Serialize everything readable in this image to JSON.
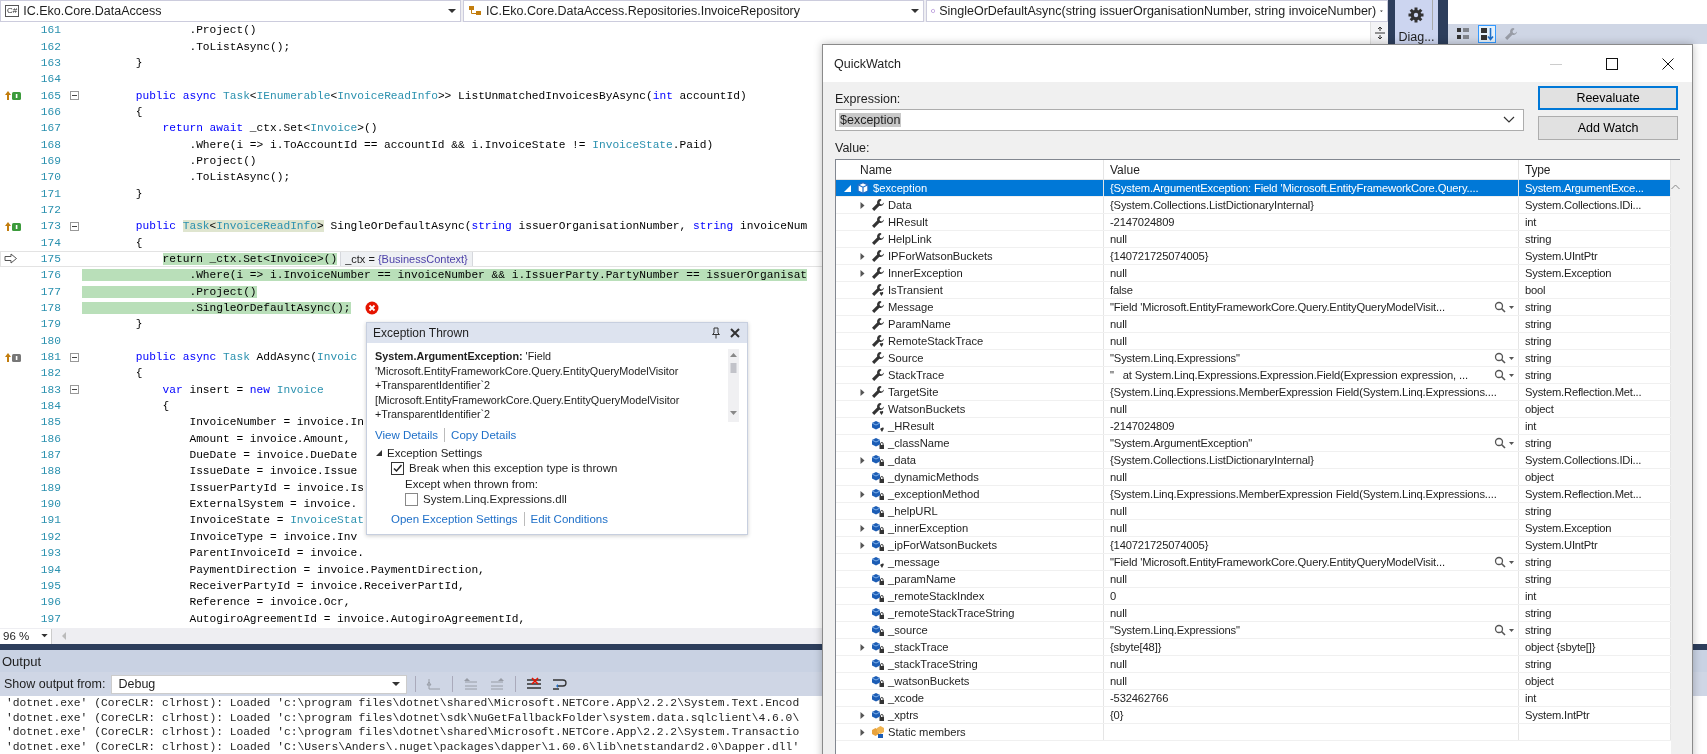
{
  "navigation_bar": {
    "project_badge": "C#",
    "project": "IC.Eko.Core.DataAccess",
    "type": "IC.Eko.Core.DataAccess.Repositories.InvoiceRepository",
    "member": "SingleOrDefaultAsync(string issuerOrganisationNumber, string invoiceNumber)"
  },
  "side_panel": {
    "tab": "Diag...",
    "properties_toolbar": [
      {
        "kind": "categorized",
        "selected": false,
        "disabled": false
      },
      {
        "kind": "alphabetical",
        "selected": true,
        "disabled": false
      },
      {
        "kind": "property-pages",
        "selected": false,
        "disabled": true
      }
    ]
  },
  "editor": {
    "zoom": "96 %",
    "lines": [
      {
        "n": "161",
        "kind": "plain",
        "fold": false,
        "highlight": false,
        "segments": [
          {
            "kind": "plain",
            "text": "                .Project()"
          }
        ]
      },
      {
        "n": "162",
        "kind": "plain",
        "fold": false,
        "highlight": false,
        "segments": [
          {
            "kind": "plain",
            "text": "                .ToListAsync();"
          }
        ]
      },
      {
        "n": "163",
        "kind": "plain",
        "fold": false,
        "highlight": false,
        "segments": [
          {
            "kind": "plain",
            "text": "        }"
          }
        ]
      },
      {
        "n": "164",
        "kind": "plain",
        "fold": false
      },
      {
        "n": "165",
        "kind": "implements",
        "fold": true,
        "highlight": false,
        "segments": [
          {
            "kind": "keyword",
            "text": "        public async"
          },
          {
            "kind": "type",
            "text": " Task"
          },
          {
            "kind": "plain",
            "text": "<"
          },
          {
            "kind": "type",
            "text": "IEnumerable"
          },
          {
            "kind": "plain",
            "text": "<"
          },
          {
            "kind": "type",
            "text": "InvoiceReadInfo"
          },
          {
            "kind": "plain",
            "text": ">> ListUnmatchedInvoicesByAsync("
          },
          {
            "kind": "keyword",
            "text": "int"
          },
          {
            "kind": "plain",
            "text": " accountId)"
          }
        ]
      },
      {
        "n": "166",
        "kind": "plain",
        "fold": false,
        "highlight": false,
        "segments": [
          {
            "kind": "plain",
            "text": "        {"
          }
        ]
      },
      {
        "n": "167",
        "kind": "plain",
        "fold": false,
        "highlight": false,
        "segments": [
          {
            "kind": "keyword",
            "text": "            return await"
          },
          {
            "kind": "plain",
            "text": " _ctx.Set<"
          },
          {
            "kind": "type",
            "text": "Invoice"
          },
          {
            "kind": "plain",
            "text": ">()"
          }
        ]
      },
      {
        "n": "168",
        "kind": "plain",
        "fold": false,
        "highlight": false,
        "segments": [
          {
            "kind": "plain",
            "text": "                .Where(i => i.ToAccountId == accountId && i.InvoiceState != "
          },
          {
            "kind": "type",
            "text": "InvoiceState"
          },
          {
            "kind": "plain",
            "text": ".Paid)"
          }
        ]
      },
      {
        "n": "169",
        "kind": "plain",
        "fold": false,
        "highlight": false,
        "segments": [
          {
            "kind": "plain",
            "text": "                .Project()"
          }
        ]
      },
      {
        "n": "170",
        "kind": "plain",
        "fold": false,
        "highlight": false,
        "segments": [
          {
            "kind": "plain",
            "text": "                .ToListAsync();"
          }
        ]
      },
      {
        "n": "171",
        "kind": "plain",
        "fold": false,
        "highlight": false,
        "segments": [
          {
            "kind": "plain",
            "text": "        }"
          }
        ]
      },
      {
        "n": "172",
        "kind": "plain",
        "fold": false
      },
      {
        "n": "173",
        "kind": "implements",
        "fold": true,
        "highlight": false,
        "segments": [
          {
            "kind": "keyword",
            "text": "        public "
          },
          {
            "kind": "ref-type",
            "text": "Task"
          },
          {
            "kind": "ref-plain",
            "text": "<"
          },
          {
            "kind": "ref-type",
            "text": "InvoiceReadInfo"
          },
          {
            "kind": "ref-plain",
            "text": ">"
          },
          {
            "kind": "plain",
            "text": " SingleOrDefaultAsync("
          },
          {
            "kind": "keyword",
            "text": "string"
          },
          {
            "kind": "plain",
            "text": " issuerOrganisationNumber, "
          },
          {
            "kind": "keyword",
            "text": "string"
          },
          {
            "kind": "plain",
            "text": " invoiceNum"
          }
        ]
      },
      {
        "n": "174",
        "kind": "plain",
        "fold": false,
        "highlight": false,
        "segments": [
          {
            "kind": "plain",
            "text": "        {"
          }
        ]
      },
      {
        "n": "175",
        "kind": "execution",
        "fold": false,
        "highlight": true,
        "datatip": {
          "label": "_ctx =",
          "value": "{BusinessContext}"
        },
        "segments": [
          {
            "kind": "keyword",
            "text": "            return"
          },
          {
            "kind": "plain",
            "text": " _ctx.Set<"
          },
          {
            "kind": "type",
            "text": "Invoice"
          },
          {
            "kind": "plain",
            "text": ">()"
          }
        ]
      },
      {
        "n": "176",
        "kind": "plain",
        "fold": false,
        "highlight": true,
        "segments": [
          {
            "kind": "plain",
            "text": "                .Where(i => i.InvoiceNumber == invoiceNumber && i.IssuerParty.PartyNumber == issuerOrganisat"
          }
        ]
      },
      {
        "n": "177",
        "kind": "plain",
        "fold": false,
        "highlight": true,
        "segments": [
          {
            "kind": "plain",
            "text": "                .Project()"
          }
        ]
      },
      {
        "n": "178",
        "kind": "plain",
        "fold": false,
        "highlight": true,
        "error": true,
        "segments": [
          {
            "kind": "plain",
            "text": "                .SingleOrDefaultAsync();"
          }
        ]
      },
      {
        "n": "179",
        "kind": "plain",
        "fold": false,
        "highlight": false,
        "segments": [
          {
            "kind": "plain",
            "text": "        }"
          }
        ]
      },
      {
        "n": "180",
        "kind": "plain",
        "fold": false
      },
      {
        "n": "181",
        "kind": "implements-inactive",
        "fold": true,
        "highlight": false,
        "segments": [
          {
            "kind": "keyword",
            "text": "        public async"
          },
          {
            "kind": "type",
            "text": " Task"
          },
          {
            "kind": "plain",
            "text": " AddAsync("
          },
          {
            "kind": "type",
            "text": "Invoic"
          }
        ]
      },
      {
        "n": "182",
        "kind": "plain",
        "fold": false,
        "highlight": false,
        "segments": [
          {
            "kind": "plain",
            "text": "        {"
          }
        ]
      },
      {
        "n": "183",
        "kind": "plain",
        "fold": true,
        "highlight": false,
        "segments": [
          {
            "kind": "keyword",
            "text": "            var"
          },
          {
            "kind": "plain",
            "text": " insert = "
          },
          {
            "kind": "keyword",
            "text": "new"
          },
          {
            "kind": "type",
            "text": " Invoice"
          }
        ]
      },
      {
        "n": "184",
        "kind": "plain",
        "fold": false,
        "highlight": false,
        "segments": [
          {
            "kind": "plain",
            "text": "            {"
          }
        ]
      },
      {
        "n": "185",
        "kind": "plain",
        "fold": false,
        "highlight": false,
        "segments": [
          {
            "kind": "plain",
            "text": "                InvoiceNumber = invoice.In"
          }
        ]
      },
      {
        "n": "186",
        "kind": "plain",
        "fold": false,
        "highlight": false,
        "segments": [
          {
            "kind": "plain",
            "text": "                Amount = invoice.Amount,"
          }
        ]
      },
      {
        "n": "187",
        "kind": "plain",
        "fold": false,
        "highlight": false,
        "segments": [
          {
            "kind": "plain",
            "text": "                DueDate = invoice.DueDate"
          }
        ]
      },
      {
        "n": "188",
        "kind": "plain",
        "fold": false,
        "highlight": false,
        "segments": [
          {
            "kind": "plain",
            "text": "                IssueDate = invoice.Issue"
          }
        ]
      },
      {
        "n": "189",
        "kind": "plain",
        "fold": false,
        "highlight": false,
        "segments": [
          {
            "kind": "plain",
            "text": "                IssuerPartyId = invoice.Is"
          }
        ]
      },
      {
        "n": "190",
        "kind": "plain",
        "fold": false,
        "highlight": false,
        "segments": [
          {
            "kind": "plain",
            "text": "                ExternalSystem = invoice."
          }
        ]
      },
      {
        "n": "191",
        "kind": "plain",
        "fold": false,
        "highlight": false,
        "segments": [
          {
            "kind": "plain",
            "text": "                InvoiceState = "
          },
          {
            "kind": "type",
            "text": "InvoiceStat"
          }
        ]
      },
      {
        "n": "192",
        "kind": "plain",
        "fold": false,
        "highlight": false,
        "segments": [
          {
            "kind": "plain",
            "text": "                InvoiceType = invoice.Inv"
          }
        ]
      },
      {
        "n": "193",
        "kind": "plain",
        "fold": false,
        "highlight": false,
        "segments": [
          {
            "kind": "plain",
            "text": "                ParentInvoiceId = invoice."
          }
        ]
      },
      {
        "n": "194",
        "kind": "plain",
        "fold": false,
        "highlight": false,
        "segments": [
          {
            "kind": "plain",
            "text": "                PaymentDirection = invoice.PaymentDirection,"
          }
        ]
      },
      {
        "n": "195",
        "kind": "plain",
        "fold": false,
        "highlight": false,
        "segments": [
          {
            "kind": "plain",
            "text": "                ReceiverPartyId = invoice.ReceiverPartId,"
          }
        ]
      },
      {
        "n": "196",
        "kind": "plain",
        "fold": false,
        "highlight": false,
        "segments": [
          {
            "kind": "plain",
            "text": "                Reference = invoice.Ocr,"
          }
        ]
      },
      {
        "n": "197",
        "kind": "plain",
        "fold": false,
        "highlight": false,
        "segments": [
          {
            "kind": "plain",
            "text": "                AutogiroAgreementId = invoice.AutogiroAgreementId,"
          }
        ]
      }
    ]
  },
  "exception_popup": {
    "title": "Exception Thrown",
    "message": "**System.ArgumentException:** 'Field 'Microsoft.EntityFrameworkCore.Query.EntityQueryModelVisitor +TransparentIdentifier`2 [Microsoft.EntityFrameworkCore.Query.EntityQueryModelVisitor +TransparentIdentifier`2",
    "links": [
      "View Details",
      "Copy Details"
    ],
    "settings": {
      "title": "Exception Settings",
      "expanded": true,
      "break_label": "Break when this exception type is thrown",
      "break_checked": true,
      "except_label": "Except when thrown from:",
      "modules": [
        {
          "label": "System.Linq.Expressions.dll",
          "checked": false
        }
      ]
    },
    "footer_links": [
      "Open Exception Settings",
      "Edit Conditions"
    ]
  },
  "output": {
    "title": "Output",
    "source_label": "Show output from:",
    "source": "Debug",
    "toolbar": [
      {
        "kind": "previous-message",
        "disabled": true
      },
      {
        "kind": "go-previous",
        "disabled": true
      },
      {
        "kind": "go-next",
        "disabled": true
      },
      {
        "kind": "clear-all",
        "disabled": false
      },
      {
        "kind": "word-wrap",
        "disabled": false
      }
    ],
    "lines": [
      "'dotnet.exe' (CoreCLR: clrhost): Loaded 'c:\\program files\\dotnet\\shared\\Microsoft.NETCore.App\\2.2.2\\System.Text.Encod",
      "'dotnet.exe' (CoreCLR: clrhost): Loaded 'c:\\program files\\dotnet\\sdk\\NuGetFallbackFolder\\system.data.sqlclient\\4.6.0\\",
      "'dotnet.exe' (CoreCLR: clrhost): Loaded 'c:\\program files\\dotnet\\shared\\Microsoft.NETCore.App\\2.2.2\\System.Transactio",
      "'dotnet.exe' (CoreCLR: clrhost): Loaded 'C:\\Users\\Anders\\.nuget\\packages\\dapper\\1.60.6\\lib\\netstandard2.0\\Dapper.dll'"
    ]
  },
  "quickwatch": {
    "title": "QuickWatch",
    "expression_label": "Expression:",
    "expression": "$exception",
    "expression_selected": true,
    "buttons": [
      {
        "label": "Reevaluate",
        "default": true
      },
      {
        "label": "Add Watch",
        "default": false
      }
    ],
    "value_label": "Value:",
    "columns": [
      "Name",
      "Value",
      "Type"
    ],
    "rows": [
      {
        "name": "$exception",
        "value": "{System.ArgumentException: Field 'Microsoft.EntityFrameworkCore.Query....",
        "type": "System.ArgumentExce...",
        "kind": "object",
        "expandable": true,
        "expanded": true,
        "visualizer": false,
        "selected": true,
        "children": [
          {
            "name": "Data",
            "value": "{System.Collections.ListDictionaryInternal}",
            "type": "System.Collections.IDi...",
            "kind": "property",
            "expandable": true,
            "expanded": false,
            "visualizer": false,
            "selected": false
          },
          {
            "name": "HResult",
            "value": "-2147024809",
            "type": "int",
            "kind": "property",
            "expandable": false,
            "visualizer": false,
            "selected": false
          },
          {
            "name": "HelpLink",
            "value": "null",
            "type": "string",
            "kind": "property",
            "expandable": false,
            "visualizer": false,
            "selected": false
          },
          {
            "name": "IPForWatsonBuckets",
            "value": "{140721725074005}",
            "type": "System.UIntPtr",
            "kind": "property",
            "expandable": true,
            "expanded": false,
            "visualizer": false,
            "selected": false
          },
          {
            "name": "InnerException",
            "value": "null",
            "type": "System.Exception",
            "kind": "property",
            "expandable": true,
            "expanded": false,
            "visualizer": false,
            "selected": false
          },
          {
            "name": "IsTransient",
            "value": "false",
            "type": "bool",
            "kind": "property-internal",
            "expandable": false,
            "visualizer": false,
            "selected": false
          },
          {
            "name": "Message",
            "value": "\"Field 'Microsoft.EntityFrameworkCore.Query.EntityQueryModelVisit...",
            "type": "string",
            "kind": "property",
            "expandable": false,
            "visualizer": true,
            "selected": false
          },
          {
            "name": "ParamName",
            "value": "null",
            "type": "string",
            "kind": "property",
            "expandable": false,
            "visualizer": false,
            "selected": false
          },
          {
            "name": "RemoteStackTrace",
            "value": "null",
            "type": "string",
            "kind": "property-internal",
            "expandable": false,
            "visualizer": false,
            "selected": false
          },
          {
            "name": "Source",
            "value": "\"System.Linq.Expressions\"",
            "type": "string",
            "kind": "property",
            "expandable": false,
            "visualizer": true,
            "selected": false
          },
          {
            "name": "StackTrace",
            "value": "\"   at System.Linq.Expressions.Expression.Field(Expression expression, ...",
            "type": "string",
            "kind": "property",
            "expandable": false,
            "visualizer": true,
            "selected": false
          },
          {
            "name": "TargetSite",
            "value": "{System.Linq.Expressions.MemberExpression Field(System.Linq.Expressions....",
            "type": "System.Reflection.Met...",
            "kind": "property",
            "expandable": true,
            "expanded": false,
            "visualizer": false,
            "selected": false
          },
          {
            "name": "WatsonBuckets",
            "value": "null",
            "type": "object",
            "kind": "property-internal",
            "expandable": false,
            "visualizer": false,
            "selected": false
          },
          {
            "name": "_HResult",
            "value": "-2147024809",
            "type": "int",
            "kind": "field-internal",
            "expandable": false,
            "visualizer": false,
            "selected": false
          },
          {
            "name": "_className",
            "value": "\"System.ArgumentException\"",
            "type": "string",
            "kind": "field-private",
            "expandable": false,
            "visualizer": true,
            "selected": false
          },
          {
            "name": "_data",
            "value": "{System.Collections.ListDictionaryInternal}",
            "type": "System.Collections.IDi...",
            "kind": "field-private",
            "expandable": true,
            "expanded": false,
            "visualizer": false,
            "selected": false
          },
          {
            "name": "_dynamicMethods",
            "value": "null",
            "type": "object",
            "kind": "field-private",
            "expandable": false,
            "visualizer": false,
            "selected": false
          },
          {
            "name": "_exceptionMethod",
            "value": "{System.Linq.Expressions.MemberExpression Field(System.Linq.Expressions....",
            "type": "System.Reflection.Met...",
            "kind": "field-private",
            "expandable": true,
            "expanded": false,
            "visualizer": false,
            "selected": false
          },
          {
            "name": "_helpURL",
            "value": "null",
            "type": "string",
            "kind": "field-private",
            "expandable": false,
            "visualizer": false,
            "selected": false
          },
          {
            "name": "_innerException",
            "value": "null",
            "type": "System.Exception",
            "kind": "field-private",
            "expandable": true,
            "expanded": false,
            "visualizer": false,
            "selected": false
          },
          {
            "name": "_ipForWatsonBuckets",
            "value": "{140721725074005}",
            "type": "System.UIntPtr",
            "kind": "field-private",
            "expandable": true,
            "expanded": false,
            "visualizer": false,
            "selected": false
          },
          {
            "name": "_message",
            "value": "\"Field 'Microsoft.EntityFrameworkCore.Query.EntityQueryModelVisit...",
            "type": "string",
            "kind": "field-internal",
            "expandable": false,
            "visualizer": true,
            "selected": false
          },
          {
            "name": "_paramName",
            "value": "null",
            "type": "string",
            "kind": "field-private",
            "expandable": false,
            "visualizer": false,
            "selected": false
          },
          {
            "name": "_remoteStackIndex",
            "value": "0",
            "type": "int",
            "kind": "field-private",
            "expandable": false,
            "visualizer": false,
            "selected": false
          },
          {
            "name": "_remoteStackTraceString",
            "value": "null",
            "type": "string",
            "kind": "field-private",
            "expandable": false,
            "visualizer": false,
            "selected": false
          },
          {
            "name": "_source",
            "value": "\"System.Linq.Expressions\"",
            "type": "string",
            "kind": "field-private",
            "expandable": false,
            "visualizer": true,
            "selected": false
          },
          {
            "name": "_stackTrace",
            "value": "{sbyte[48]}",
            "type": "object {sbyte[]}",
            "kind": "field-private",
            "expandable": true,
            "expanded": false,
            "visualizer": false,
            "selected": false
          },
          {
            "name": "_stackTraceString",
            "value": "null",
            "type": "string",
            "kind": "field-private",
            "expandable": false,
            "visualizer": false,
            "selected": false
          },
          {
            "name": "_watsonBuckets",
            "value": "null",
            "type": "object",
            "kind": "field-private",
            "expandable": false,
            "visualizer": false,
            "selected": false
          },
          {
            "name": "_xcode",
            "value": "-532462766",
            "type": "int",
            "kind": "field-private",
            "expandable": false,
            "visualizer": false,
            "selected": false
          },
          {
            "name": "_xptrs",
            "value": "{0}",
            "type": "System.IntPtr",
            "kind": "field-private",
            "expandable": true,
            "expanded": false,
            "visualizer": false,
            "selected": false
          },
          {
            "name": "Static members",
            "kind": "static",
            "expandable": true,
            "expanded": false,
            "visualizer": false,
            "selected": false
          }
        ]
      }
    ]
  }
}
